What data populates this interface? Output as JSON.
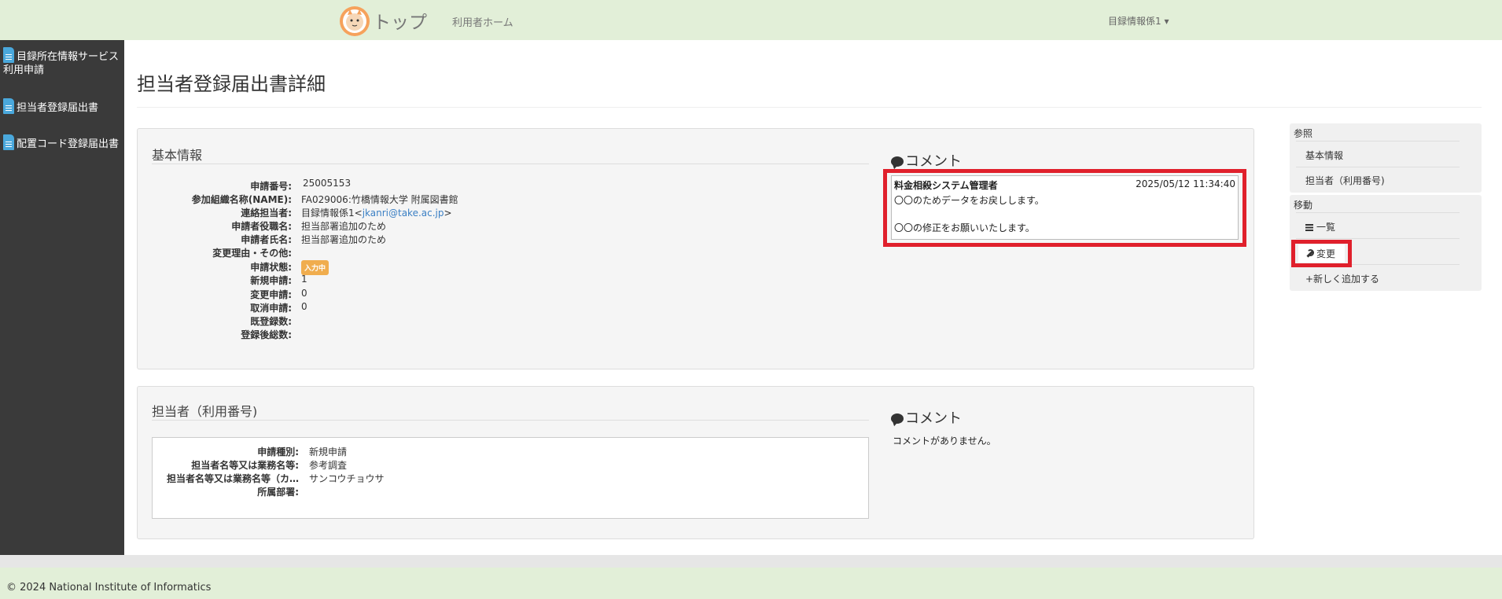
{
  "header": {
    "title": "トップ",
    "home_link": "利用者ホーム",
    "user_menu": "目録情報係1 ▾"
  },
  "sidebar": {
    "items": [
      {
        "label": "目録所在情報サービス利用申請"
      },
      {
        "label": "担当者登録届出書"
      },
      {
        "label": "配置コード登録届出書"
      }
    ]
  },
  "page": {
    "title": "担当者登録届出書詳細"
  },
  "basic": {
    "section_title": "基本情報",
    "fields": [
      {
        "label": "申請番号:",
        "value": "25005153"
      },
      {
        "label": "参加組織名称(NAME):",
        "value": "FA029006:竹橋情報大学 附属図書館"
      },
      {
        "label": "連絡担当者:",
        "value": "目録情報係1<",
        "email": "jkanri@take.ac.jp",
        "suffix": ">"
      },
      {
        "label": "申請者役職名:",
        "value": "担当部署追加のため"
      },
      {
        "label": "申請者氏名:",
        "value": "担当部署追加のため"
      },
      {
        "label": "変更理由・その他:",
        "value": ""
      },
      {
        "label": "申請状態:",
        "badge": "入力中"
      },
      {
        "label": "新規申請:",
        "value": "1"
      },
      {
        "label": "変更申請:",
        "value": "0"
      },
      {
        "label": "取消申請:",
        "value": "0"
      },
      {
        "label": "既登録数:",
        "value": ""
      },
      {
        "label": "登録後総数:",
        "value": ""
      }
    ],
    "comment": {
      "heading": "コメント",
      "author": "料金相殺システム管理者",
      "timestamp": "2025/05/12 11:34:40",
      "line1": "〇〇のためデータをお戻しします。",
      "line2": "〇〇の修正をお願いいたします。"
    }
  },
  "staff": {
    "section_title": "担当者（利用番号)",
    "fields": [
      {
        "label": "申請種別:",
        "value": "新規申請"
      },
      {
        "label": "担当者名等又は業務名等:",
        "value": "参考調査"
      },
      {
        "label": "担当者名等又は業務名等（カ…",
        "value": "サンコウチョウサ"
      },
      {
        "label": "所属部署:",
        "value": ""
      }
    ],
    "comment": {
      "heading": "コメント",
      "empty": "コメントがありません。"
    }
  },
  "right_nav": {
    "ref_heading": "参照",
    "ref_items": [
      "基本情報",
      "担当者（利用番号)"
    ],
    "move_heading": "移動",
    "list_label": "一覧",
    "edit_label": "変更",
    "add_label": "+新しく追加する"
  },
  "footer": {
    "text": "© 2024 National Institute of Informatics"
  },
  "colors": {
    "header_bg": "#e2efd8",
    "sidebar_bg": "#3a3a3a",
    "highlight": "#e0202c",
    "badge": "#f0ad4e",
    "link": "#3a7fc4"
  }
}
